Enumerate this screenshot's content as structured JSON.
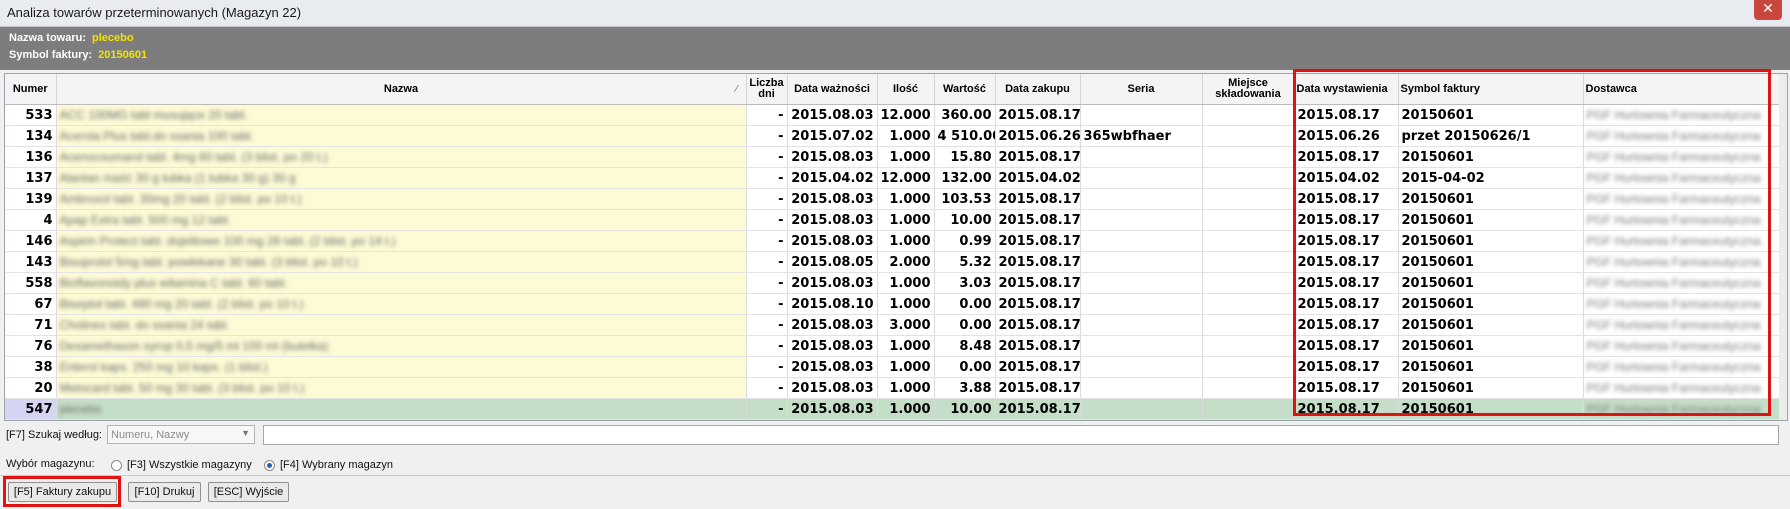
{
  "window": {
    "title": "Analiza towarów przeterminowanych (Magazyn 22)",
    "close_label": "✕"
  },
  "info": {
    "product_label": "Nazwa towaru:",
    "product_value": "plecebo",
    "invoice_label": "Symbol faktury:",
    "invoice_value": "20150601"
  },
  "table": {
    "headers": {
      "numer": "Numer",
      "nazwa": "Nazwa",
      "liczba_dni": "Liczba dni",
      "data_waznosci": "Data ważności",
      "ilosc": "Ilość",
      "wartosc": "Wartość",
      "data_zakupu": "Data zakupu",
      "seria": "Seria",
      "miejsce": "Miejsce składowania",
      "data_wyst": "Data wystawienia",
      "symbol": "Symbol faktury",
      "dostawca": "Dostawca"
    },
    "rows": [
      {
        "numer": "533",
        "nazwa": "ACC 100MG tabl musujące 20 tabl.",
        "dni": "-",
        "waz": "2015.08.03",
        "ilosc": "12.000",
        "wart": "360.00",
        "zak": "2015.08.17",
        "seria": "",
        "miejsce": "",
        "wyst": "2015.08.17",
        "symbol": "20150601",
        "dost": "PGF Hurtownia Farmaceutyczna"
      },
      {
        "numer": "134",
        "nazwa": "Acerola Plus tabl.do ssania 100 tabl.",
        "dni": "-",
        "waz": "2015.07.02",
        "ilosc": "1.000",
        "wart": "4 510.00",
        "zak": "2015.06.26",
        "seria": "365wbfhaer",
        "miejsce": "",
        "wyst": "2015.06.26",
        "symbol": "przet 20150626/1",
        "dost": "PGF Hurtownia Farmaceutyczna"
      },
      {
        "numer": "136",
        "nazwa": "Acenocoumarol tabl. 4mg 60 tabl. (3 blist. po 20 t.)",
        "dni": "-",
        "waz": "2015.08.03",
        "ilosc": "1.000",
        "wart": "15.80",
        "zak": "2015.08.17",
        "seria": "",
        "miejsce": "",
        "wyst": "2015.08.17",
        "symbol": "20150601",
        "dost": "PGF Hurtownia Farmaceutyczna"
      },
      {
        "numer": "137",
        "nazwa": "Alantan maść 30 g tubka (1 tubka 30 g) 30 g",
        "dni": "-",
        "waz": "2015.04.02",
        "ilosc": "12.000",
        "wart": "132.00",
        "zak": "2015.04.02",
        "seria": "",
        "miejsce": "",
        "wyst": "2015.04.02",
        "symbol": "2015-04-02",
        "dost": "PGF Hurtownia Farmaceutyczna"
      },
      {
        "numer": "139",
        "nazwa": "Ambroxol tabl. 30mg 20 tabl. (2 blist. po 10 t.)",
        "dni": "-",
        "waz": "2015.08.03",
        "ilosc": "1.000",
        "wart": "103.53",
        "zak": "2015.08.17",
        "seria": "",
        "miejsce": "",
        "wyst": "2015.08.17",
        "symbol": "20150601",
        "dost": "PGF Hurtownia Farmaceutyczna"
      },
      {
        "numer": "4",
        "nazwa": "Apap Extra tabl. 500 mg 12 tabl.",
        "dni": "-",
        "waz": "2015.08.03",
        "ilosc": "1.000",
        "wart": "10.00",
        "zak": "2015.08.17",
        "seria": "",
        "miejsce": "",
        "wyst": "2015.08.17",
        "symbol": "20150601",
        "dost": "PGF Hurtownia Farmaceutyczna"
      },
      {
        "numer": "146",
        "nazwa": "Aspirin Protect tabl. dojelitowe 100 mg 28 tabl. (2 blist. po 14 t.)",
        "dni": "-",
        "waz": "2015.08.03",
        "ilosc": "1.000",
        "wart": "0.99",
        "zak": "2015.08.17",
        "seria": "",
        "miejsce": "",
        "wyst": "2015.08.17",
        "symbol": "20150601",
        "dost": "PGF Hurtownia Farmaceutyczna"
      },
      {
        "numer": "143",
        "nazwa": "Bisoprolol 5mg tabl. powlekane 30 tabl. (3 blist. po 10 t.)",
        "dni": "-",
        "waz": "2015.08.05",
        "ilosc": "2.000",
        "wart": "5.32",
        "zak": "2015.08.17",
        "seria": "",
        "miejsce": "",
        "wyst": "2015.08.17",
        "symbol": "20150601",
        "dost": "PGF Hurtownia Farmaceutyczna"
      },
      {
        "numer": "558",
        "nazwa": "Bioflavonoidy plus witamina C tabl. 60 tabl.",
        "dni": "-",
        "waz": "2015.08.03",
        "ilosc": "1.000",
        "wart": "3.03",
        "zak": "2015.08.17",
        "seria": "",
        "miejsce": "",
        "wyst": "2015.08.17",
        "symbol": "20150601",
        "dost": "PGF Hurtownia Farmaceutyczna"
      },
      {
        "numer": "67",
        "nazwa": "Biseptol tabl. 480 mg 20 tabl. (2 blist. po 10 t.)",
        "dni": "-",
        "waz": "2015.08.10",
        "ilosc": "1.000",
        "wart": "0.00",
        "zak": "2015.08.17",
        "seria": "",
        "miejsce": "",
        "wyst": "2015.08.17",
        "symbol": "20150601",
        "dost": "PGF Hurtownia Farmaceutyczna"
      },
      {
        "numer": "71",
        "nazwa": "Cholinex tabl. do ssania 24 tabl.",
        "dni": "-",
        "waz": "2015.08.03",
        "ilosc": "3.000",
        "wart": "0.00",
        "zak": "2015.08.17",
        "seria": "",
        "miejsce": "",
        "wyst": "2015.08.17",
        "symbol": "20150601",
        "dost": "PGF Hurtownia Farmaceutyczna"
      },
      {
        "numer": "76",
        "nazwa": "Dexamethason syrop 0,5 mg/5 ml 100 ml (butelka)",
        "dni": "-",
        "waz": "2015.08.03",
        "ilosc": "1.000",
        "wart": "8.48",
        "zak": "2015.08.17",
        "seria": "",
        "miejsce": "",
        "wyst": "2015.08.17",
        "symbol": "20150601",
        "dost": "PGF Hurtownia Farmaceutyczna"
      },
      {
        "numer": "38",
        "nazwa": "Enterol kaps. 250 mg 10 kaps. (1 blist.)",
        "dni": "-",
        "waz": "2015.08.03",
        "ilosc": "1.000",
        "wart": "0.00",
        "zak": "2015.08.17",
        "seria": "",
        "miejsce": "",
        "wyst": "2015.08.17",
        "symbol": "20150601",
        "dost": "PGF Hurtownia Farmaceutyczna"
      },
      {
        "numer": "20",
        "nazwa": "Metocard tabl. 50 mg 30 tabl. (3 blist. po 10 t.)",
        "dni": "-",
        "waz": "2015.08.03",
        "ilosc": "1.000",
        "wart": "3.88",
        "zak": "2015.08.17",
        "seria": "",
        "miejsce": "",
        "wyst": "2015.08.17",
        "symbol": "20150601",
        "dost": "PGF Hurtownia Farmaceutyczna"
      },
      {
        "numer": "547",
        "nazwa": "plecebo",
        "dni": "-",
        "waz": "2015.08.03",
        "ilosc": "1.000",
        "wart": "10.00",
        "zak": "2015.08.17",
        "seria": "",
        "miejsce": "",
        "wyst": "2015.08.17",
        "symbol": "20150601",
        "dost": "PGF Hurtownia Farmaceutyczna",
        "selected": true
      }
    ]
  },
  "search": {
    "label": "[F7] Szukaj według:",
    "combo_value": "Numeru, Nazwy",
    "input_value": ""
  },
  "warehouse": {
    "label": "Wybór magazynu:",
    "opt_all": "[F3]  Wszystkie magazyny",
    "opt_selected": "[F4]  Wybrany magazyn"
  },
  "buttons": {
    "invoices": "[F5] Faktury zakupu",
    "print": "[F10] Drukuj",
    "exit": "[ESC] Wyjście"
  },
  "colors": {
    "highlight": "#e01313",
    "info_value": "#f0e400",
    "selected_row": "#c5dec8"
  }
}
